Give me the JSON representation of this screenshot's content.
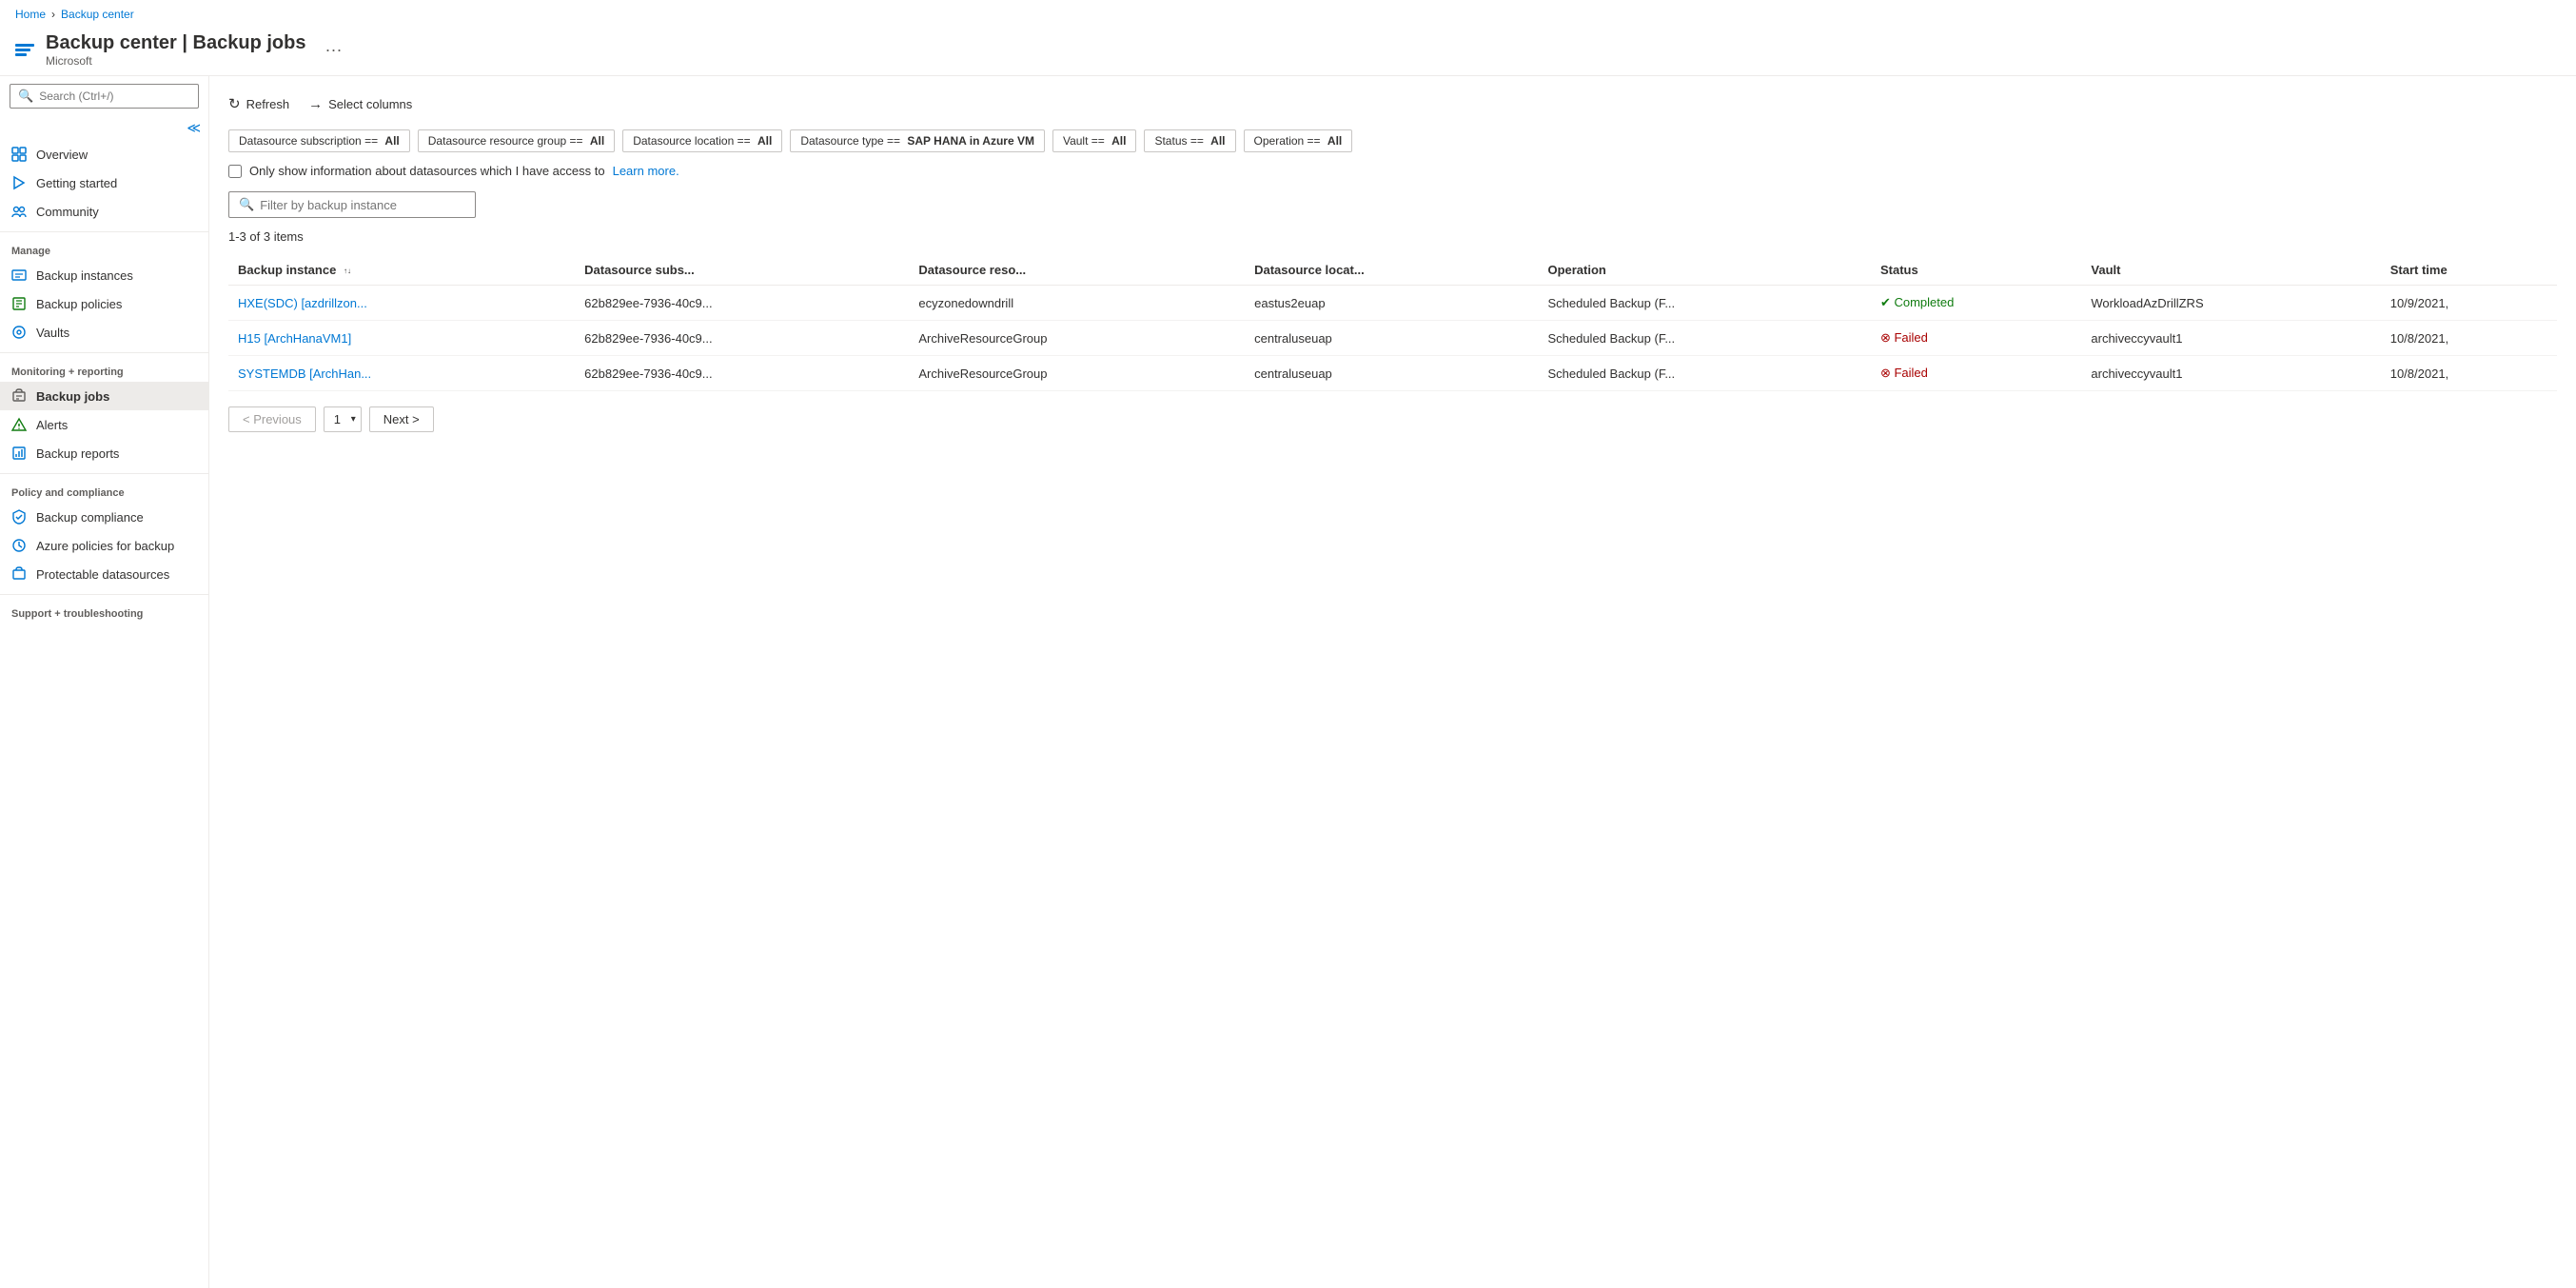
{
  "breadcrumb": {
    "home": "Home",
    "current": "Backup center"
  },
  "header": {
    "title": "Backup center | Backup jobs",
    "subtitle": "Microsoft",
    "menu_icon": "···"
  },
  "sidebar": {
    "search_placeholder": "Search (Ctrl+/)",
    "collapse_tooltip": "Collapse",
    "items": [
      {
        "id": "overview",
        "label": "Overview",
        "icon": "overview"
      },
      {
        "id": "getting-started",
        "label": "Getting started",
        "icon": "lightning"
      },
      {
        "id": "community",
        "label": "Community",
        "icon": "community"
      }
    ],
    "manage_section": "Manage",
    "manage_items": [
      {
        "id": "backup-instances",
        "label": "Backup instances",
        "icon": "instances"
      },
      {
        "id": "backup-policies",
        "label": "Backup policies",
        "icon": "policies"
      },
      {
        "id": "vaults",
        "label": "Vaults",
        "icon": "vaults"
      }
    ],
    "monitoring_section": "Monitoring + reporting",
    "monitoring_items": [
      {
        "id": "backup-jobs",
        "label": "Backup jobs",
        "icon": "jobs",
        "active": true
      },
      {
        "id": "alerts",
        "label": "Alerts",
        "icon": "alerts"
      },
      {
        "id": "backup-reports",
        "label": "Backup reports",
        "icon": "reports"
      }
    ],
    "policy_section": "Policy and compliance",
    "policy_items": [
      {
        "id": "backup-compliance",
        "label": "Backup compliance",
        "icon": "compliance"
      },
      {
        "id": "azure-policies",
        "label": "Azure policies for backup",
        "icon": "azure-policy"
      },
      {
        "id": "protectable-sources",
        "label": "Protectable datasources",
        "icon": "protectable"
      }
    ],
    "support_section": "Support + troubleshooting"
  },
  "toolbar": {
    "refresh_label": "Refresh",
    "columns_label": "Select columns"
  },
  "filters": [
    {
      "id": "subscription",
      "label": "Datasource subscription",
      "operator": "==",
      "value": "All"
    },
    {
      "id": "resource-group",
      "label": "Datasource resource group",
      "operator": "==",
      "value": "All"
    },
    {
      "id": "location",
      "label": "Datasource location",
      "operator": "==",
      "value": "All"
    },
    {
      "id": "type",
      "label": "Datasource type",
      "operator": "==",
      "value": "SAP HANA in Azure VM"
    },
    {
      "id": "vault",
      "label": "Vault",
      "operator": "==",
      "value": "All"
    },
    {
      "id": "status",
      "label": "Status",
      "operator": "==",
      "value": "All"
    },
    {
      "id": "operation",
      "label": "Operation",
      "operator": "==",
      "value": "All"
    }
  ],
  "access_checkbox": {
    "label": "Only show information about datasources which I have access to",
    "link_text": "Learn more.",
    "checked": false
  },
  "instance_filter": {
    "placeholder": "Filter by backup instance"
  },
  "items_count": "1-3 of 3 items",
  "table": {
    "columns": [
      {
        "id": "instance",
        "label": "Backup instance",
        "sortable": true
      },
      {
        "id": "subscription",
        "label": "Datasource subs..."
      },
      {
        "id": "resource-group",
        "label": "Datasource reso..."
      },
      {
        "id": "location",
        "label": "Datasource locat..."
      },
      {
        "id": "operation",
        "label": "Operation"
      },
      {
        "id": "status",
        "label": "Status"
      },
      {
        "id": "vault",
        "label": "Vault"
      },
      {
        "id": "start-time",
        "label": "Start time"
      }
    ],
    "rows": [
      {
        "instance": "HXE(SDC) [azdrillzon...",
        "subscription": "62b829ee-7936-40c9...",
        "resource_group": "ecyzonedowndrill",
        "location": "eastus2euap",
        "operation": "Scheduled Backup (F...",
        "status": "Completed",
        "status_type": "completed",
        "vault": "WorkloadAzDrillZRS",
        "start_time": "10/9/2021,"
      },
      {
        "instance": "H15 [ArchHanaVM1]",
        "subscription": "62b829ee-7936-40c9...",
        "resource_group": "ArchiveResourceGroup",
        "location": "centraluseuap",
        "operation": "Scheduled Backup (F...",
        "status": "Failed",
        "status_type": "failed",
        "vault": "archiveccyvault1",
        "start_time": "10/8/2021,"
      },
      {
        "instance": "SYSTEMDB [ArchHan...",
        "subscription": "62b829ee-7936-40c9...",
        "resource_group": "ArchiveResourceGroup",
        "location": "centraluseuap",
        "operation": "Scheduled Backup (F...",
        "status": "Failed",
        "status_type": "failed",
        "vault": "archiveccyvault1",
        "start_time": "10/8/2021,"
      }
    ]
  },
  "pagination": {
    "previous_label": "< Previous",
    "next_label": "Next >",
    "current_page": "1",
    "page_options": [
      "1"
    ]
  }
}
